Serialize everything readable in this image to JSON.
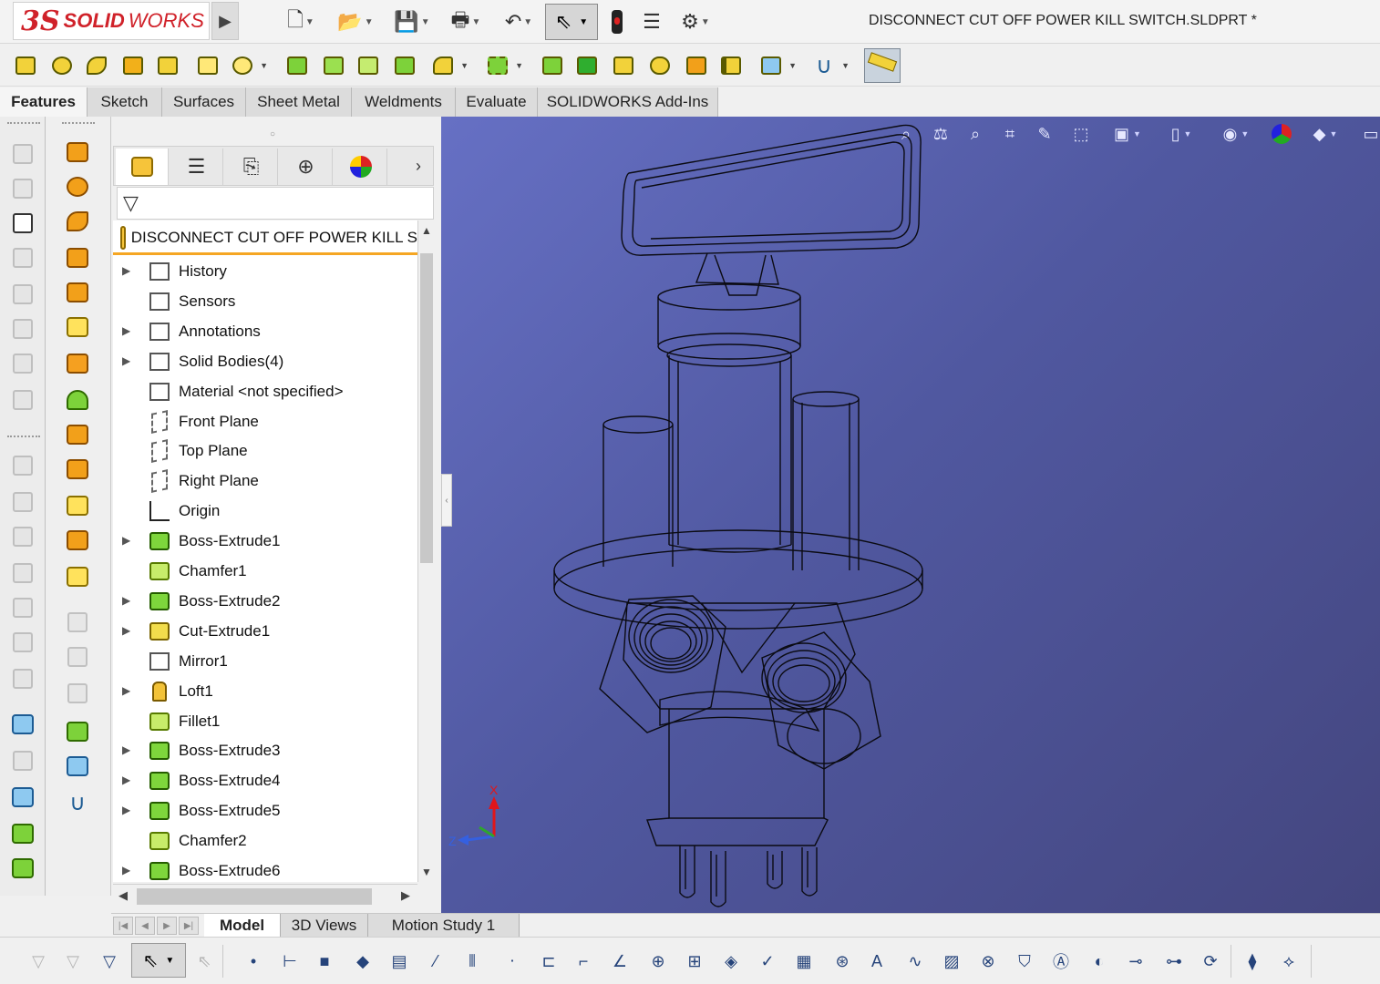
{
  "app": {
    "logo_ds": "3S",
    "logo_solid": "SOLID",
    "logo_works": "WORKS",
    "window_title": "DISCONNECT CUT OFF POWER KILL SWITCH.SLDPRT *"
  },
  "ribbon_tabs": [
    "Features",
    "Sketch",
    "Surfaces",
    "Sheet Metal",
    "Weldments",
    "Evaluate",
    "SOLIDWORKS Add-Ins"
  ],
  "feature_tree": {
    "root_label": "DISCONNECT CUT OFF POWER KILL S",
    "items": [
      {
        "label": "History",
        "icon": "history-icon",
        "expandable": true
      },
      {
        "label": "Sensors",
        "icon": "sensor-icon",
        "expandable": false
      },
      {
        "label": "Annotations",
        "icon": "annotation-icon",
        "expandable": true
      },
      {
        "label": "Solid Bodies(4)",
        "icon": "solid-bodies-icon",
        "expandable": true
      },
      {
        "label": "Material <not specified>",
        "icon": "material-icon",
        "expandable": false
      },
      {
        "label": "Front Plane",
        "icon": "plane-icon",
        "expandable": false
      },
      {
        "label": "Top Plane",
        "icon": "plane-icon",
        "expandable": false
      },
      {
        "label": "Right Plane",
        "icon": "plane-icon",
        "expandable": false
      },
      {
        "label": "Origin",
        "icon": "origin-icon",
        "expandable": false
      },
      {
        "label": "Boss-Extrude1",
        "icon": "extrude-icon",
        "expandable": true
      },
      {
        "label": "Chamfer1",
        "icon": "chamfer-icon",
        "expandable": false
      },
      {
        "label": "Boss-Extrude2",
        "icon": "extrude-icon",
        "expandable": true
      },
      {
        "label": "Cut-Extrude1",
        "icon": "cut-extrude-icon",
        "expandable": true
      },
      {
        "label": "Mirror1",
        "icon": "mirror-icon",
        "expandable": false
      },
      {
        "label": "Loft1",
        "icon": "loft-icon",
        "expandable": true
      },
      {
        "label": "Fillet1",
        "icon": "fillet-icon",
        "expandable": false
      },
      {
        "label": "Boss-Extrude3",
        "icon": "extrude-icon",
        "expandable": true
      },
      {
        "label": "Boss-Extrude4",
        "icon": "extrude-icon",
        "expandable": true
      },
      {
        "label": "Boss-Extrude5",
        "icon": "extrude-icon",
        "expandable": true
      },
      {
        "label": "Chamfer2",
        "icon": "chamfer-icon",
        "expandable": false
      },
      {
        "label": "Boss-Extrude6",
        "icon": "extrude-icon",
        "expandable": true
      }
    ]
  },
  "bottom_tabs": [
    "Model",
    "3D Views",
    "Motion Study 1"
  ],
  "triad": {
    "x": "X",
    "z": "Z"
  },
  "colors": {
    "accent": "#f5a623",
    "viewport_top": "#6670c4",
    "viewport_bottom": "#44467f",
    "brand_red": "#d0222a"
  }
}
